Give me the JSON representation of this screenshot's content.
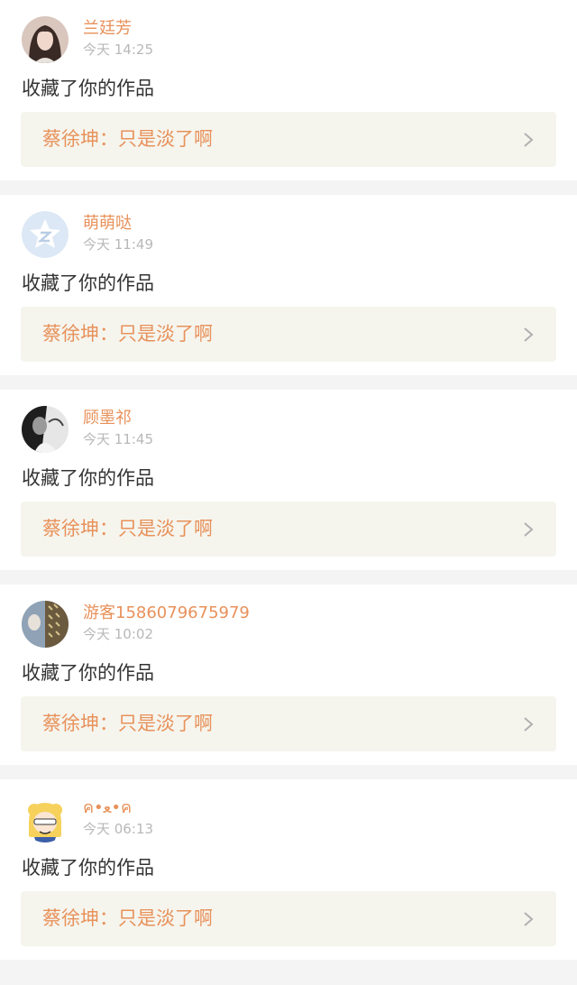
{
  "notifications": [
    {
      "name": "兰廷芳",
      "time": "今天 14:25",
      "action": "收藏了你的作品",
      "work": "蔡徐坤：只是淡了啊",
      "avatar": "photo-avatar-woman"
    },
    {
      "name": "萌萌哒",
      "time": "今天 11:49",
      "action": "收藏了你的作品",
      "work": "蔡徐坤：只是淡了啊",
      "avatar": "qzone-star-avatar"
    },
    {
      "name": "顾墨祁",
      "time": "今天 11:45",
      "action": "收藏了你的作品",
      "work": "蔡徐坤：只是淡了啊",
      "avatar": "photo-avatar-bw"
    },
    {
      "name": "游客1586079675979",
      "time": "今天 10:02",
      "action": "收藏了你的作品",
      "work": "蔡徐坤：只是淡了啊",
      "avatar": "photo-avatar-pattern"
    },
    {
      "name": "ค•ﻌ•ค",
      "time": "今天 06:13",
      "action": "收藏了你的作品",
      "work": "蔡徐坤：只是淡了啊",
      "avatar": "cartoon-avatar"
    }
  ],
  "colors": {
    "accent": "#e8915a",
    "time": "#b8b8b8",
    "text": "#333333",
    "work_bg": "#f5f5ee",
    "divider": "#f4f4f4"
  }
}
